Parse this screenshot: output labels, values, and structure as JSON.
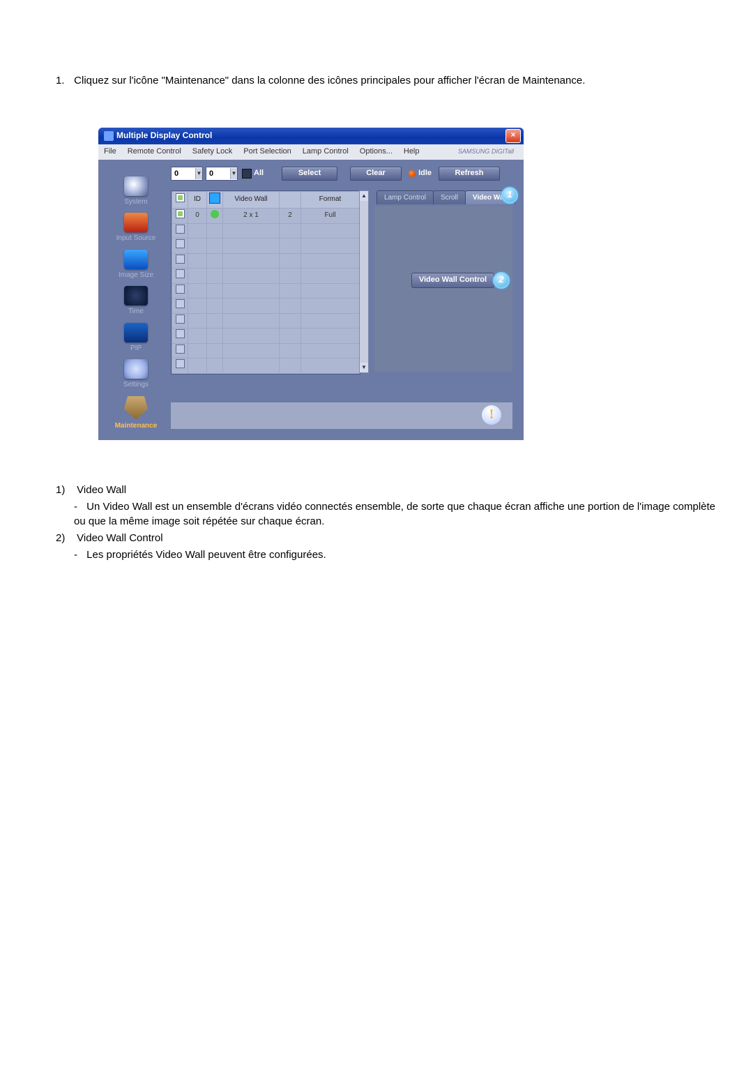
{
  "intro": {
    "number": "1.",
    "text": "Cliquez sur l'icône \"Maintenance\" dans la colonne des icônes principales pour afficher l'écran de Maintenance."
  },
  "window": {
    "title": "Multiple Display Control",
    "brand": "SAMSUNG DIGITall",
    "close": "×",
    "menus": [
      "File",
      "Remote Control",
      "Safety Lock",
      "Port Selection",
      "Lamp Control",
      "Options...",
      "Help"
    ]
  },
  "sidebar": {
    "items": [
      {
        "label": "System"
      },
      {
        "label": "Input Source"
      },
      {
        "label": "Image Size"
      },
      {
        "label": "Time"
      },
      {
        "label": "PIP"
      },
      {
        "label": "Settings"
      },
      {
        "label": "Maintenance"
      }
    ]
  },
  "topbar": {
    "combo1": "0",
    "combo2": "0",
    "all": "All",
    "select": "Select",
    "clear": "Clear",
    "idle": "Idle",
    "refresh": "Refresh"
  },
  "tabs": {
    "items": [
      "Lamp Control",
      "Scroll",
      "Video Wall"
    ],
    "activeIndex": 2
  },
  "callouts": {
    "c1": "1",
    "c2": "2"
  },
  "table": {
    "headers": {
      "chk": "✓",
      "id": "ID",
      "status": "",
      "vw": "Video Wall",
      "num": "",
      "format": "Format"
    },
    "row0": {
      "id": "0",
      "vw": "2 x 1",
      "num": "2",
      "format": "Full"
    }
  },
  "vwc_button": "Video Wall Control",
  "alert": "!",
  "notes": {
    "n1_num": "1)",
    "n1_label": "Video Wall",
    "n1_sub": "Un Video Wall est un ensemble d'écrans vidéo connectés ensemble, de sorte que chaque écran affiche une portion de l'image complète ou que la même image soit répétée sur chaque écran.",
    "n2_num": "2)",
    "n2_label": "Video Wall Control",
    "n2_sub": "Les propriétés Video Wall peuvent être configurées."
  }
}
